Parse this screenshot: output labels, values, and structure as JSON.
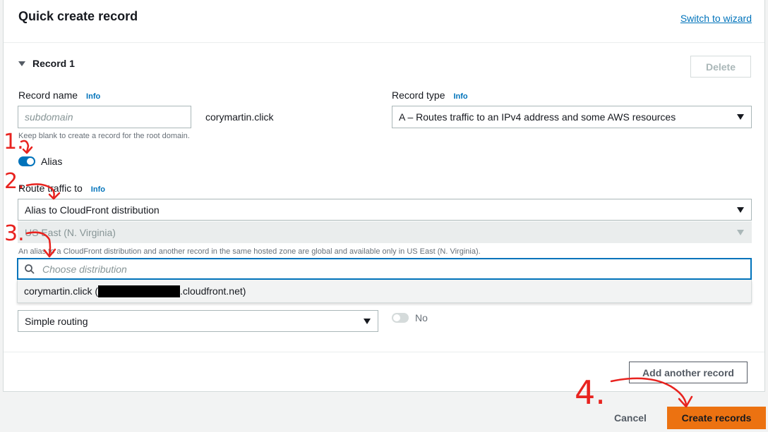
{
  "header": {
    "title": "Quick create record",
    "switch_link": "Switch to wizard"
  },
  "record": {
    "section_title": "Record 1",
    "delete_label": "Delete",
    "record_name": {
      "label": "Record name",
      "info": "Info",
      "placeholder": "subdomain",
      "domain_suffix": "corymartin.click",
      "help": "Keep blank to create a record for the root domain."
    },
    "record_type": {
      "label": "Record type",
      "info": "Info",
      "value": "A – Routes traffic to an IPv4 address and some AWS resources"
    },
    "alias": {
      "label": "Alias",
      "enabled": true
    },
    "route_traffic": {
      "label": "Route traffic to",
      "info": "Info",
      "endpoint_value": "Alias to CloudFront distribution",
      "region_value": "US East (N. Virginia)",
      "region_help": "An alias to a CloudFront distribution and another record in the same hosted zone are global and available only in US East (N. Virginia).",
      "search_placeholder": "Choose distribution",
      "option_prefix": "corymartin.click (",
      "option_suffix": ".cloudfront.net)"
    },
    "routing_policy": {
      "value": "Simple routing"
    },
    "evaluate_health": {
      "value_label": "No",
      "enabled": false
    }
  },
  "footer": {
    "add_record_label": "Add another record",
    "cancel_label": "Cancel",
    "create_label": "Create records"
  },
  "annotations": {
    "step1": "1.",
    "step2": "2.",
    "step3": "3.",
    "step4": "4."
  },
  "colors": {
    "accent": "#0073bb",
    "primary_button": "#ec7211",
    "annotation": "#e8231f"
  }
}
